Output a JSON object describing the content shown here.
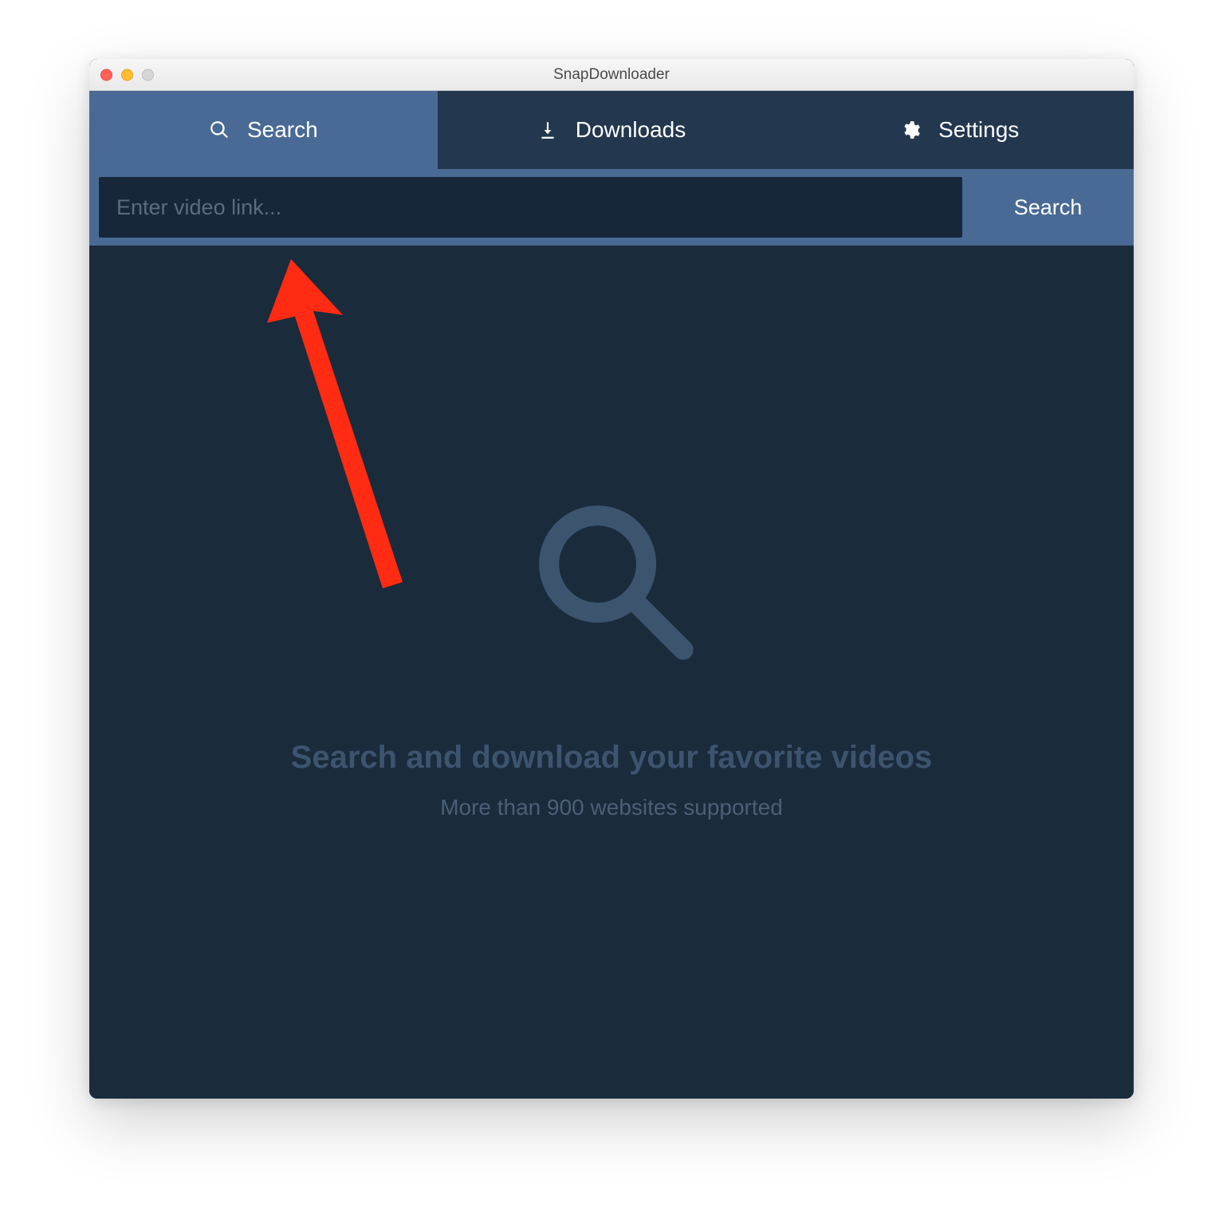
{
  "window": {
    "title": "SnapDownloader"
  },
  "tabs": {
    "search": {
      "label": "Search"
    },
    "downloads": {
      "label": "Downloads"
    },
    "settings": {
      "label": "Settings"
    }
  },
  "search_bar": {
    "placeholder": "Enter video link...",
    "button_label": "Search"
  },
  "hero": {
    "title": "Search and download your favorite videos",
    "subtitle": "More than 900 websites supported"
  }
}
